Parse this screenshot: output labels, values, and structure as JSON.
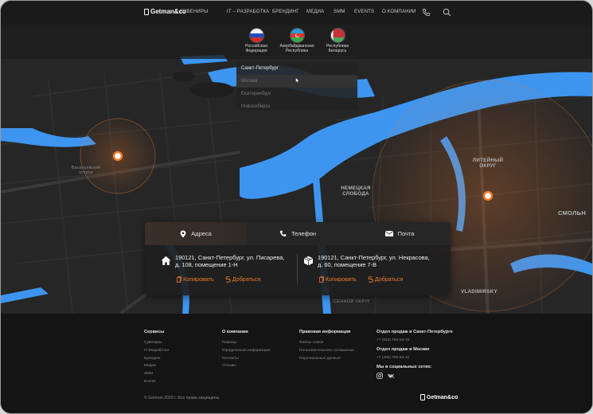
{
  "header": {
    "logo_text": "Getman&co",
    "nav": [
      "СУВЕНИРЫ",
      "IT – РАЗРАБОТКА",
      "БРЕНДИНГ",
      "МЕДИА",
      "SMM",
      "EVENTS",
      "О КОМПАНИИ"
    ],
    "icons": [
      "phone-icon",
      "search-icon"
    ]
  },
  "countries": [
    {
      "line1": "Российская",
      "line2": "Федерация",
      "flag": "russia-flag"
    },
    {
      "line1": "Азербайджанская",
      "line2": "Республика",
      "flag": "azerbaijan-flag"
    },
    {
      "line1": "Республика",
      "line2": "Беларусь",
      "flag": "belarus-flag"
    }
  ],
  "cities": [
    {
      "name": "Санкт-Петербург",
      "state": "selected"
    },
    {
      "name": "Москва",
      "state": "hover"
    },
    {
      "name": "Екатеринбург",
      "state": "normal"
    },
    {
      "name": "Новосибирск",
      "state": "normal"
    }
  ],
  "map_labels": {
    "vasilevsky": "Васильевский остров",
    "liteiny": "ЛИТЕЙНЫЙ ОКРУГ",
    "nemetskaya": "НЕМЕЦКАЯ СЛОБОДА",
    "smolny": "СМОЛЬН",
    "vladimirsky": "VLADIMIRSKY",
    "sennoy": "СЕННОЙ ОКРУГ"
  },
  "contact": {
    "tabs": [
      {
        "label": "Адреса",
        "icon": "location-pin-icon",
        "active": true
      },
      {
        "label": "Телефон",
        "icon": "phone-icon",
        "active": false
      },
      {
        "label": "Почта",
        "icon": "envelope-icon",
        "active": false
      }
    ],
    "addresses": [
      {
        "icon": "house-icon",
        "line1": "190121, Санкт-Петербург, ул. Писарева,",
        "line2": "д. 108, помещение 1-Н",
        "copy": "Копировать",
        "route": "Добраться"
      },
      {
        "icon": "box-icon",
        "line1": "190121, Санкт-Петербург, ул. Некрасова,",
        "line2": "д. 60, помещение 7-В",
        "copy": "Копировать",
        "route": "Добраться"
      }
    ]
  },
  "footer": {
    "columns": [
      {
        "title": "Сервисы",
        "links": [
          "Сувениры",
          "IT-Разработка",
          "Брендинг",
          "Медиа",
          "SMM",
          "Events"
        ]
      },
      {
        "title": "О компании",
        "links": [
          "Помощь",
          "Юридическая информация",
          "Контакты",
          "Отзывы"
        ]
      },
      {
        "title": "Правовая информация",
        "links": [
          "Файлы cookie",
          "Пользовательское соглашение",
          "Персональные данные"
        ]
      }
    ],
    "sales": {
      "spb_title": "Отдел продаж в Санкт-Петербурге",
      "spb_phone": "+7 (812) 762-54-15",
      "msk_title": "Отдел продаж в Москве",
      "msk_phone": "+7 (495) 762-54-15",
      "social_title": "Мы в социальных сетях:",
      "social_icons": [
        "instagram-icon",
        "vk-icon"
      ]
    },
    "copyright": "© Getman 2020 г. Все права защищены.",
    "logo_text": "Getman&co"
  },
  "colors": {
    "water": "#3d95f0",
    "accent": "#ee7a2e",
    "map_land": "#252525",
    "footer_bg": "#141414"
  }
}
